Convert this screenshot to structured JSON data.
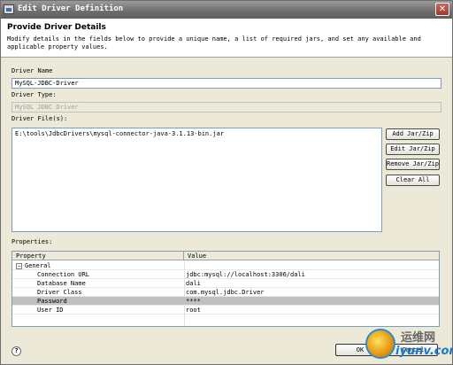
{
  "window": {
    "title": "Edit Driver Definition",
    "close_glyph": "✕"
  },
  "header": {
    "title": "Provide Driver Details",
    "description": "Modify details in the fields below to provide a unique name, a list of required jars, and set any available and applicable property values."
  },
  "form": {
    "driver_name_label": "Driver Name",
    "driver_name_value": "MySQL-JDBC-Driver",
    "driver_type_label": "Driver Type:",
    "driver_type_value": "MySQL JDBC Driver",
    "driver_files_label": "Driver File(s):",
    "driver_files": [
      "E:\\tools\\JdbcDrivers\\mysql-connector-java-3.1.13-bin.jar"
    ],
    "buttons": {
      "add": "Add Jar/Zip",
      "edit": "Edit Jar/Zip",
      "remove": "Remove Jar/Zip",
      "clear": "Clear All"
    }
  },
  "properties": {
    "label": "Properties:",
    "columns": [
      "Property",
      "Value"
    ],
    "group": "General",
    "rows": [
      {
        "key": "Connection URL",
        "value": "jdbc:mysql://localhost:3306/dali"
      },
      {
        "key": "Database Name",
        "value": "dali"
      },
      {
        "key": "Driver Class",
        "value": "com.mysql.jdbc.Driver"
      },
      {
        "key": "Password",
        "value": "****"
      },
      {
        "key": "User ID",
        "value": "root"
      }
    ],
    "selected_row": "Password"
  },
  "footer": {
    "help_glyph": "?",
    "ok": "OK",
    "cancel": "Cancel"
  },
  "watermark": {
    "text1": "运维网",
    "text2": "iyunv.com"
  }
}
